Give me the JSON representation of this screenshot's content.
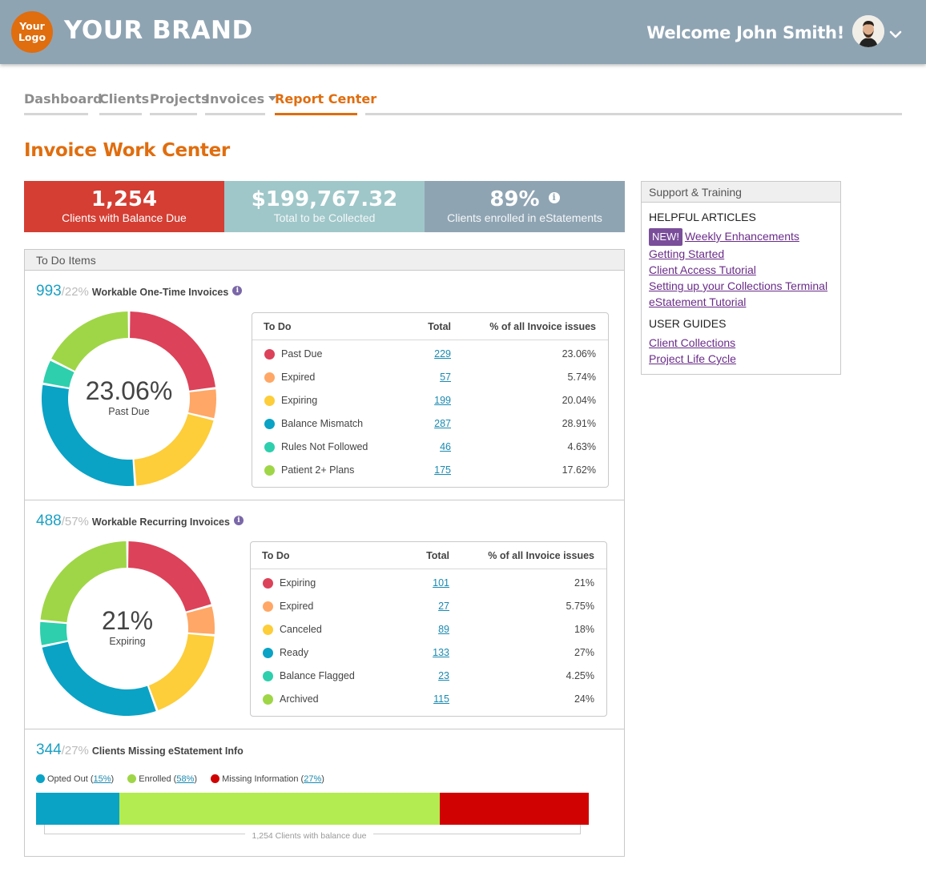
{
  "header": {
    "logo_line1": "Your",
    "logo_line2": "Logo",
    "brand": "YOUR BRAND",
    "welcome": "Welcome John Smith!",
    "avatar": "user-avatar",
    "colors": {
      "bar": "#8fa4b3",
      "accent": "#e06d0e"
    }
  },
  "nav": {
    "tabs": [
      {
        "label": "Dashboard",
        "active": false
      },
      {
        "label": "Clients",
        "active": false
      },
      {
        "label": "Projects",
        "active": false
      },
      {
        "label": "Invoices",
        "active": false,
        "dropdown": true
      },
      {
        "label": "Report Center",
        "active": true
      }
    ]
  },
  "page_title": "Invoice Work Center",
  "kpis": [
    {
      "value": "1,254",
      "label": "Clients with Balance Due",
      "color": "#d43e33"
    },
    {
      "value": "$199,767.32",
      "label": "Total to be Collected",
      "color": "#9fc7c9"
    },
    {
      "value": "89%",
      "label": "Clients enrolled in eStatements",
      "color": "#8fa4b3",
      "icon": "info-icon"
    }
  ],
  "todo": {
    "title": "To Do Items",
    "columns": {
      "todo": "To Do",
      "total": "Total",
      "percent": "% of all Invoice issues"
    },
    "one_time": {
      "count": "993",
      "share": "/22%",
      "name": "Workable One-Time Invoices",
      "center_value": "23.06%",
      "center_label": "Past Due",
      "rows": [
        {
          "label": "Past Due",
          "total": "229",
          "percent": "23.06%",
          "color": "#dc4259"
        },
        {
          "label": "Expired",
          "total": "57",
          "percent": "5.74%",
          "color": "#ffa766"
        },
        {
          "label": "Expiring",
          "total": "199",
          "percent": "20.04%",
          "color": "#fdcd3a"
        },
        {
          "label": "Balance Mismatch",
          "total": "287",
          "percent": "28.91%",
          "color": "#0aa3c6"
        },
        {
          "label": "Rules Not Followed",
          "total": "46",
          "percent": "4.63%",
          "color": "#2ecfad"
        },
        {
          "label": "Patient 2+ Plans",
          "total": "175",
          "percent": "17.62%",
          "color": "#9fd647"
        }
      ]
    },
    "recurring": {
      "count": "488",
      "share": "/57%",
      "name": "Workable Recurring Invoices",
      "center_value": "21%",
      "center_label": "Expiring",
      "rows": [
        {
          "label": "Expiring",
          "total": "101",
          "percent": "21%",
          "color": "#dc4259"
        },
        {
          "label": "Expired",
          "total": "27",
          "percent": "5.75%",
          "color": "#ffa766"
        },
        {
          "label": "Canceled",
          "total": "89",
          "percent": "18%",
          "color": "#fdcd3a"
        },
        {
          "label": "Ready",
          "total": "133",
          "percent": "27%",
          "color": "#0aa3c6"
        },
        {
          "label": "Balance Flagged",
          "total": "23",
          "percent": "4.25%",
          "color": "#2ecfad"
        },
        {
          "label": "Archived",
          "total": "115",
          "percent": "24%",
          "color": "#9fd647"
        }
      ]
    },
    "estatement": {
      "count": "344",
      "share": "/27%",
      "name": "Clients Missing eStatement Info",
      "legend": [
        {
          "label": "Opted Out",
          "value": "15%",
          "color": "#0aa3c6"
        },
        {
          "label": "Enrolled",
          "value": "58%",
          "color": "#b3ec50"
        },
        {
          "label": "Missing Information",
          "value": "27%",
          "color": "#d10202"
        }
      ],
      "axis_label": "1,254 Clients with balance due"
    }
  },
  "chart_data": [
    {
      "type": "pie",
      "series_name": "",
      "categories": [
        "Past Due",
        "Expired",
        "Expiring",
        "Balance Mismatch",
        "Rules Not Followed",
        "Patient 2+ Plans"
      ],
      "values": [
        229,
        57,
        199,
        287,
        46,
        175
      ],
      "colors": [
        "#dc4259",
        "#ffa766",
        "#fdcd3a",
        "#0aa3c6",
        "#2ecfad",
        "#9fd647"
      ]
    },
    {
      "type": "pie",
      "series_name": "",
      "categories": [
        "Expiring",
        "Expired",
        "Canceled",
        "Ready",
        "Balance Flagged",
        "Archived"
      ],
      "values": [
        101,
        27,
        89,
        133,
        23,
        115
      ],
      "colors": [
        "#dc4259",
        "#ffa766",
        "#fdcd3a",
        "#0aa3c6",
        "#2ecfad",
        "#9fd647"
      ]
    },
    {
      "type": "bar",
      "stacked": true,
      "categories": [
        "Opted Out",
        "Enrolled",
        "Missing Information"
      ],
      "values": [
        15,
        58,
        27
      ],
      "colors": [
        "#0aa3c6",
        "#b3ec50",
        "#d10202"
      ]
    }
  ],
  "support": {
    "title": "Support & Training",
    "helpful_heading": "HELPFUL ARTICLES",
    "new_badge": "NEW!",
    "helpful_links": [
      "Weekly Enhancements",
      "Getting Started",
      "Client Access Tutorial",
      "Setting up your Collections Terminal",
      "eStatement Tutorial"
    ],
    "guides_heading": "USER GUIDES",
    "guide_links": [
      "Client Collections",
      "Project Life Cycle"
    ]
  }
}
